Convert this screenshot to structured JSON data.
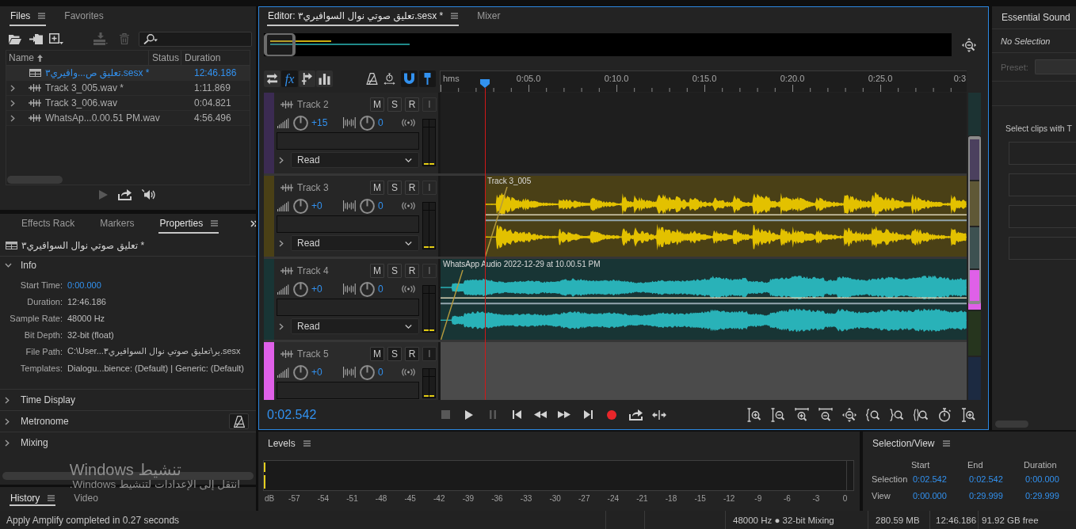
{
  "files_panel": {
    "tabs": [
      {
        "label": "Files",
        "selected": true
      },
      {
        "label": "Favorites",
        "selected": false
      }
    ],
    "toolbar": [
      {
        "kind": "open",
        "disabled": false
      },
      {
        "kind": "import",
        "disabled": false
      },
      {
        "kind": "new",
        "disabled": false
      },
      {
        "kind": "insert",
        "disabled": true
      },
      {
        "kind": "delete",
        "disabled": true
      }
    ],
    "columns": [
      "Name",
      "Status",
      "Duration"
    ],
    "rows": [
      {
        "kind": "session",
        "name": "تعليق ص...وافيري٣.sesx *",
        "duration": "12:46.186",
        "selected": true
      },
      {
        "kind": "audio",
        "name": "Track 3_005.wav *",
        "duration": "1:11.869",
        "selected": false
      },
      {
        "kind": "audio",
        "name": "Track 3_006.wav",
        "duration": "0:04.821",
        "selected": false
      },
      {
        "kind": "audio",
        "name": "WhatsAp...0.00.51 PM.wav",
        "duration": "4:56.496",
        "selected": false
      }
    ],
    "controls": [
      {
        "kind": "play",
        "disabled": true
      },
      {
        "kind": "loop",
        "disabled": false
      },
      {
        "kind": "autoplay",
        "disabled": false
      }
    ]
  },
  "properties_panel": {
    "tabs": [
      {
        "label": "Effects Rack",
        "selected": false
      },
      {
        "label": "Markers",
        "selected": false
      },
      {
        "label": "Properties",
        "selected": true
      }
    ],
    "title": "تعليق صوتي نوال السوافيري٣ *",
    "sections": [
      {
        "kind": "info",
        "label": "Info",
        "expanded": true,
        "fields": [
          {
            "label": "Start Time:",
            "value": "0:00.000",
            "editable": true
          },
          {
            "label": "Duration:",
            "value": "12:46.186",
            "editable": false
          },
          {
            "label": "Sample Rate:",
            "value": "48000 Hz",
            "editable": false
          },
          {
            "label": "Bit Depth:",
            "value": "32-bit (float)",
            "editable": false
          },
          {
            "label": "File Path:",
            "value": "C:\\User...ير\\تعليق صوتي نوال السوافيري٣.sesx",
            "editable": false
          },
          {
            "label": "Templates:",
            "value": "Dialogu...bience: (Default) | Generic: (Default)",
            "editable": false
          }
        ]
      },
      {
        "kind": "plain",
        "label": "Time Display",
        "expanded": false
      },
      {
        "kind": "toggle",
        "label": "Metronome",
        "expanded": false,
        "on": false
      },
      {
        "kind": "plain",
        "label": "Mixing",
        "expanded": false
      }
    ]
  },
  "history_panel": {
    "tabs": [
      {
        "label": "History",
        "selected": true
      },
      {
        "label": "Video",
        "selected": false
      }
    ]
  },
  "editor": {
    "tabs": [
      {
        "label": "Editor: تعليق صوتي نوال السوافيري٣.sesx *",
        "selected": true
      },
      {
        "label": "Mixer",
        "selected": false
      }
    ],
    "tools": [
      {
        "kind": "swap",
        "on": false
      },
      {
        "kind": "fx",
        "label": "fx",
        "on": true
      },
      {
        "kind": "send",
        "on": false
      },
      {
        "kind": "bars",
        "on": false
      },
      {
        "kind": "metronome",
        "on": false
      },
      {
        "kind": "stretch",
        "on": false
      },
      {
        "kind": "snap",
        "on": true
      },
      {
        "kind": "marker",
        "on": true
      }
    ],
    "ruler": {
      "unit": "hms",
      "labels": [
        "0:05.0",
        "0:10.0",
        "0:15.0",
        "0:20.0",
        "0:25.0",
        "0:3"
      ]
    },
    "playhead": {
      "level": 0.0847
    },
    "tracks": [
      {
        "name": "Track 2",
        "color": "#3b2b52",
        "selected": false,
        "buttons": [
          {
            "label": "M",
            "disabled": false
          },
          {
            "label": "S",
            "disabled": false
          },
          {
            "label": "R",
            "disabled": false
          },
          {
            "label": "I",
            "disabled": true
          }
        ],
        "volume": "+15",
        "pan": "0",
        "automation": "Read"
      },
      {
        "name": "Track 3",
        "color": "#4a4016",
        "selected": false,
        "buttons": [
          {
            "label": "M",
            "disabled": false
          },
          {
            "label": "S",
            "disabled": false
          },
          {
            "label": "R",
            "disabled": false
          },
          {
            "label": "I",
            "disabled": true
          }
        ],
        "volume": "+0",
        "pan": "0",
        "automation": "Read",
        "clip": {
          "title": "Track 3_005",
          "color": "#e3c100"
        }
      },
      {
        "name": "Track 4",
        "color": "#183535",
        "selected": false,
        "buttons": [
          {
            "label": "M",
            "disabled": false
          },
          {
            "label": "S",
            "disabled": false
          },
          {
            "label": "R",
            "disabled": false
          },
          {
            "label": "I",
            "disabled": true
          }
        ],
        "volume": "+0",
        "pan": "0",
        "automation": "Read",
        "clip": {
          "title": "WhatsApp Audio 2022-12-29 at 10.00.51 PM",
          "color": "#29b2b8"
        }
      },
      {
        "name": "Track 5",
        "color": "#e060e8",
        "selected": true,
        "buttons": [
          {
            "label": "M",
            "disabled": false
          },
          {
            "label": "S",
            "disabled": false
          },
          {
            "label": "R",
            "disabled": false
          },
          {
            "label": "I",
            "disabled": true
          }
        ],
        "volume": "+0",
        "pan": "0"
      }
    ],
    "time": "0:02.542",
    "transport": [
      {
        "kind": "stop",
        "disabled": true
      },
      {
        "kind": "play",
        "disabled": false
      },
      {
        "kind": "pause",
        "disabled": true
      },
      {
        "kind": "start",
        "disabled": false
      },
      {
        "kind": "rewind",
        "disabled": false
      },
      {
        "kind": "forward",
        "disabled": false
      },
      {
        "kind": "end",
        "disabled": false
      },
      {
        "kind": "record",
        "disabled": false
      },
      {
        "kind": "loop",
        "disabled": false
      },
      {
        "kind": "skip",
        "disabled": false
      }
    ]
  },
  "essential_sound": {
    "title": "Essential Sound",
    "status": "No Selection",
    "preset": {
      "label": "Preset:",
      "disabled": true
    },
    "hint": "Select clips with T"
  },
  "levels": {
    "title": "Levels",
    "scale": [
      "dB",
      "-57",
      "-54",
      "-51",
      "-48",
      "-45",
      "-42",
      "-39",
      "-36",
      "-33",
      "-30",
      "-27",
      "-24",
      "-21",
      "-18",
      "-15",
      "-12",
      "-9",
      "-6",
      "-3",
      "0"
    ]
  },
  "selection_view": {
    "title": "Selection/View",
    "columns": [
      "Start",
      "End",
      "Duration"
    ],
    "rows": [
      {
        "label": "Selection",
        "values": [
          "0:02.542",
          "0:02.542",
          "0:00.000"
        ]
      },
      {
        "label": "View",
        "values": [
          "0:00.000",
          "0:29.999",
          "0:29.999"
        ]
      }
    ]
  },
  "status_bar": {
    "message": "Apply Amplify completed in 0.27 seconds",
    "items": [
      "48000 Hz ● 32-bit Mixing",
      "280.59 MB",
      "12:46.186",
      "91.92 GB free"
    ]
  },
  "activation_notice": {
    "title": "تنشيط Windows",
    "subtitle": "انتقل إلى الإعدادات لتنشيط Windows."
  }
}
